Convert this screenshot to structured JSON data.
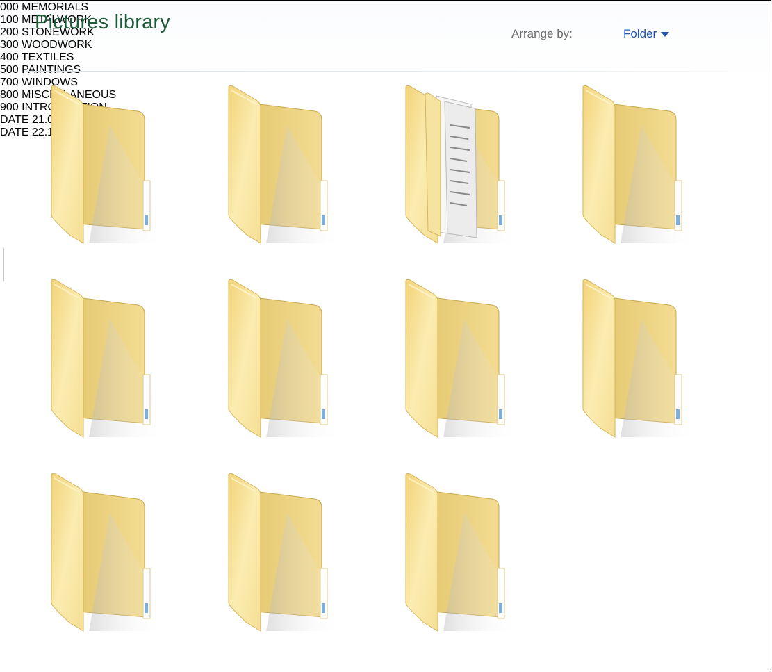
{
  "header": {
    "title": "Pictures library",
    "arrange_label": "Arrange by:",
    "arrange_value": "Folder"
  },
  "folders": [
    {
      "label": "000 MEMORIALS",
      "icon": "folder-icon"
    },
    {
      "label": "100 METALWORK",
      "icon": "folder-icon"
    },
    {
      "label": "200 STONEWORK",
      "icon": "folder-with-documents-icon"
    },
    {
      "label": "300 WOODWORK",
      "icon": "folder-icon"
    },
    {
      "label": "400 TEXTILES",
      "icon": "folder-icon"
    },
    {
      "label": "500 PAINTINGS",
      "icon": "folder-icon"
    },
    {
      "label": "700 WINDOWS",
      "icon": "folder-icon"
    },
    {
      "label": "800 MISCELLANEOUS",
      "icon": "folder-icon"
    },
    {
      "label": "900 INTRODUCTION",
      "icon": "folder-icon"
    },
    {
      "label": "DATE  21.06.16",
      "icon": "folder-icon"
    },
    {
      "label": "DATE 22.11.03",
      "icon": "folder-icon"
    }
  ],
  "colors": {
    "title": "#1e5c3a",
    "link": "#1e57b0",
    "folder_back": "#e8cd77",
    "folder_front": "#f9e9a8"
  }
}
